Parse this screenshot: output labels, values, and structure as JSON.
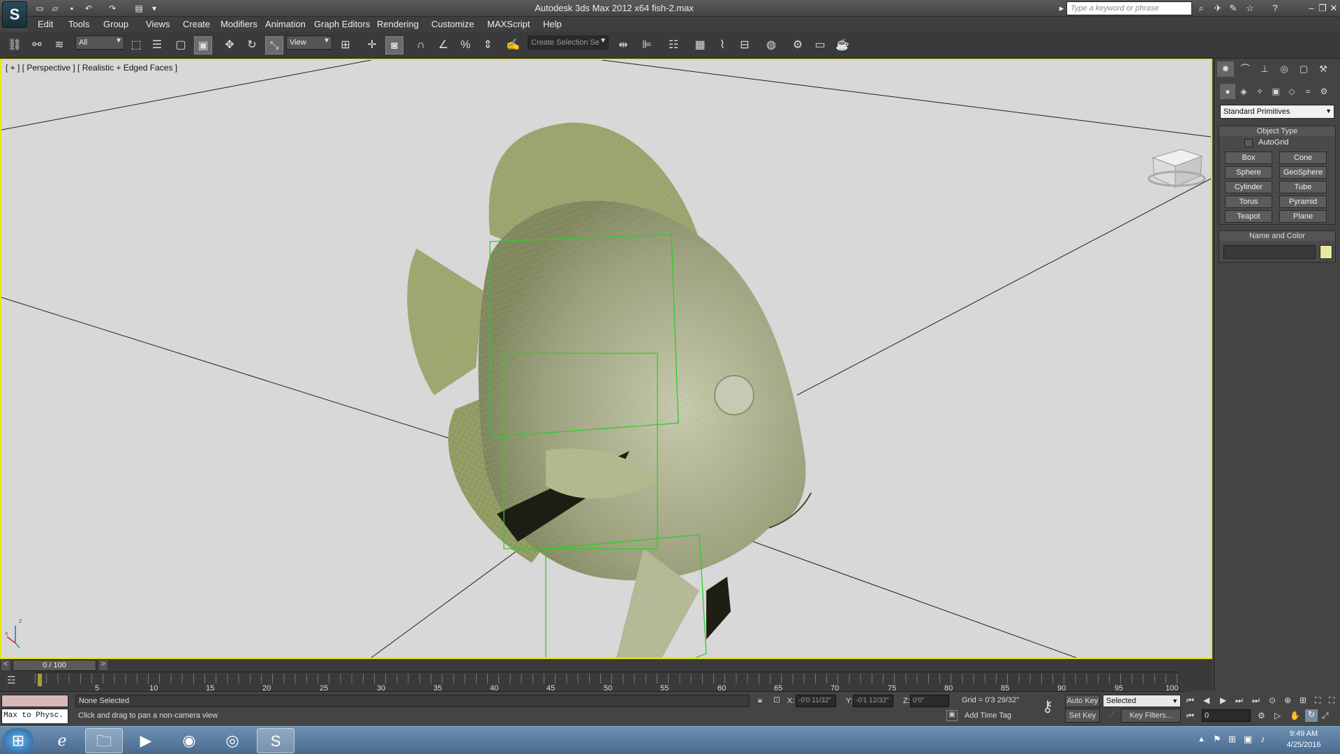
{
  "window": {
    "title": "Autodesk 3ds Max  2012 x64     fish-2.max",
    "search_placeholder": "Type a keyword or phrase"
  },
  "menus": [
    "Edit",
    "Tools",
    "Group",
    "Views",
    "Create",
    "Modifiers",
    "Animation",
    "Graph Editors",
    "Rendering",
    "Customize",
    "MAXScript",
    "Help"
  ],
  "toolbar": {
    "filter_select": "All",
    "ref_coord_select": "View",
    "named_selection": "Create Selection Se"
  },
  "viewport": {
    "label": "[ + ] [ Perspective ] [ Realistic + Edged Faces ]",
    "background": "#d8d8d8",
    "wire_color": "#a8c020",
    "bbox_color": "#2ecc2e",
    "axis": {
      "z": "z",
      "x": "x"
    }
  },
  "command_panel": {
    "category": "Standard Primitives",
    "object_type_title": "Object Type",
    "autogrid_label": "AutoGrid",
    "primitives": [
      "Box",
      "Cone",
      "Sphere",
      "GeoSphere",
      "Cylinder",
      "Tube",
      "Torus",
      "Pyramid",
      "Teapot",
      "Plane"
    ],
    "name_color_title": "Name and Color",
    "swatch_color": "#e8e8a0"
  },
  "timeline": {
    "frame_label": "0 / 100",
    "ticks": [
      "5",
      "10",
      "15",
      "20",
      "25",
      "30",
      "35",
      "40",
      "45",
      "50",
      "55",
      "60",
      "65",
      "70",
      "75",
      "80",
      "85",
      "90",
      "95",
      "100"
    ]
  },
  "status": {
    "script_listener": "Max to Physc.",
    "selection": "None Selected",
    "prompt": "Click and drag to pan a non-camera view",
    "x_label": "X:",
    "x_value": "-0'0 11/32\"",
    "y_label": "Y:",
    "y_value": "-0'1 12/32\"",
    "z_label": "Z:",
    "z_value": "0'0\"",
    "grid": "Grid = 0'3 29/32\"",
    "add_time_tag": "Add Time Tag",
    "auto_key": "Auto Key",
    "set_key": "Set Key",
    "key_mode": "Selected",
    "key_filters": "Key Filters...",
    "frame": "0"
  },
  "taskbar": {
    "time": "9:49 AM",
    "date": "4/25/2016"
  }
}
